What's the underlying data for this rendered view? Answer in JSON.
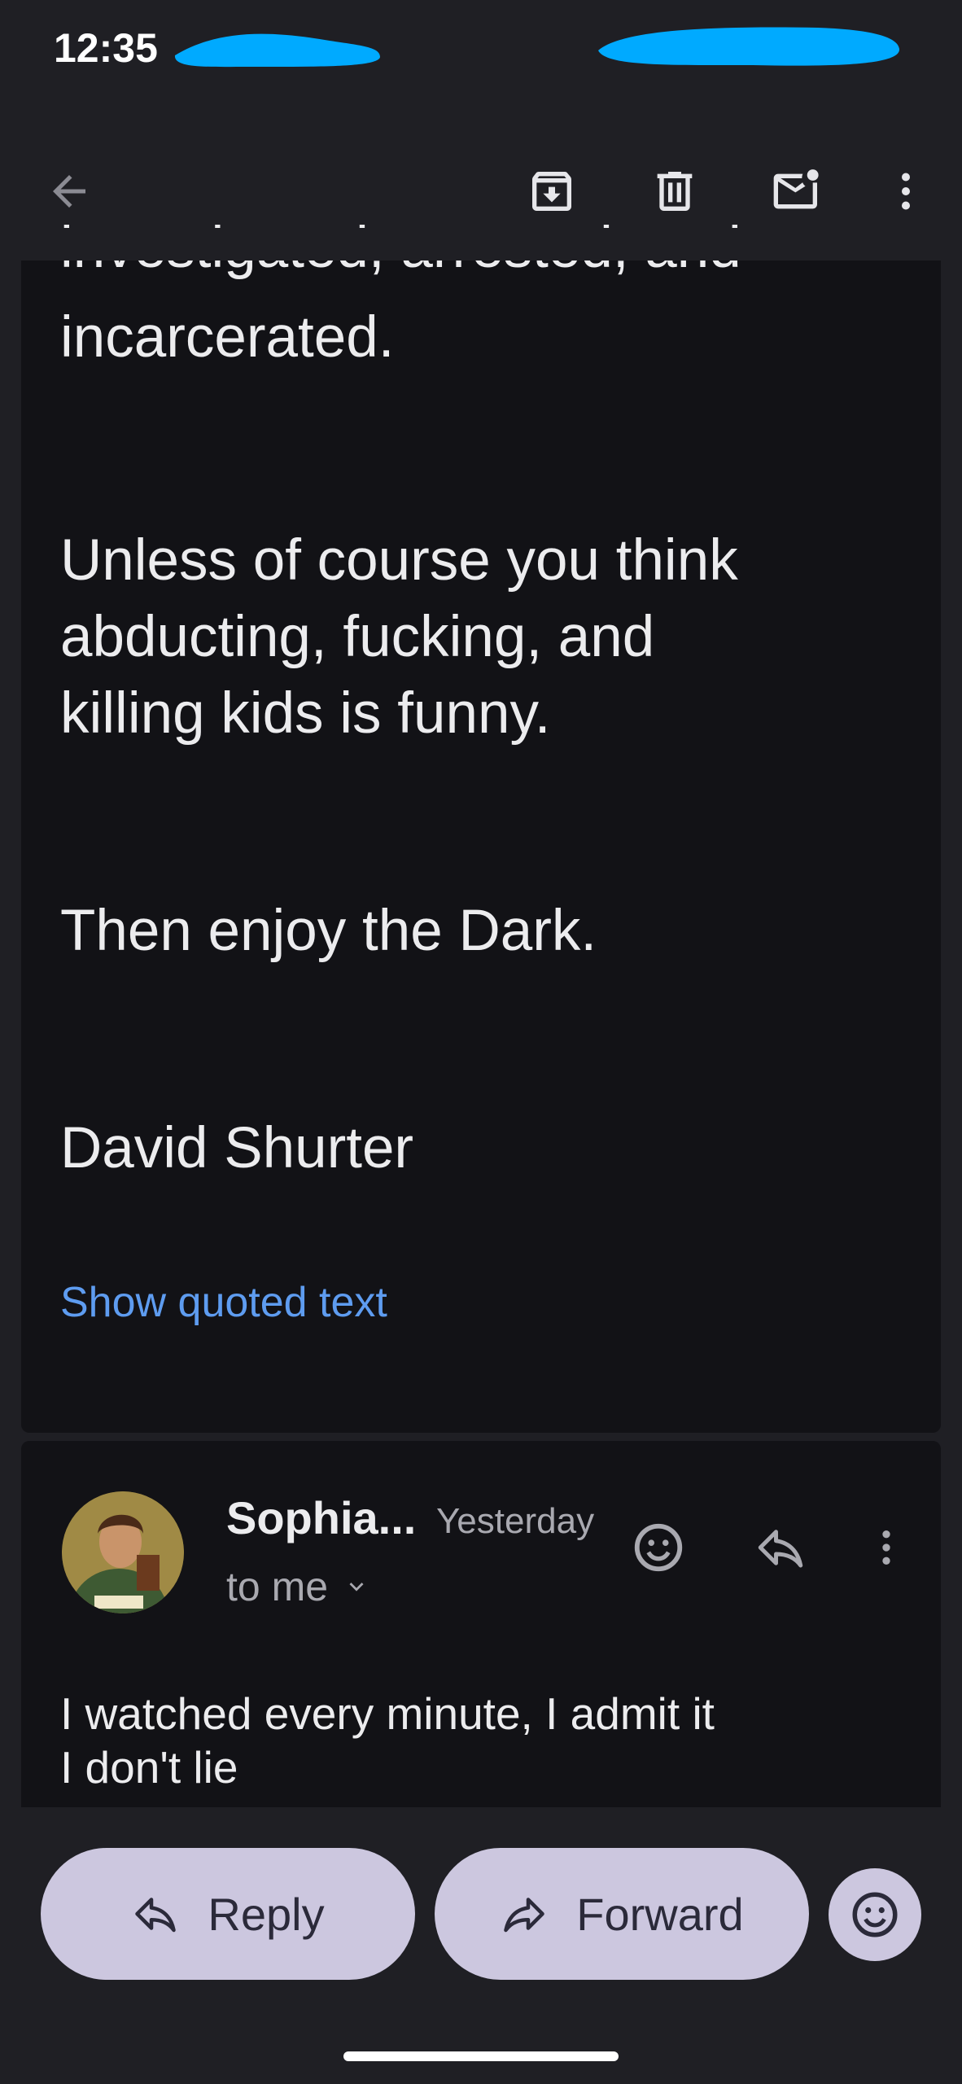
{
  "status_bar": {
    "time": "12:35"
  },
  "toolbar": {
    "back_icon": "arrow-left-icon",
    "archive_icon": "archive-icon",
    "delete_icon": "trash-icon",
    "mark_unread_icon": "mail-unread-icon",
    "more_icon": "more-vert-icon"
  },
  "email1": {
    "partial_line": "investigated, arrested, and",
    "paragraphs": [
      "incarcerated.",
      "Unless of course you think\nabducting, fucking, and\nkilling kids is funny.",
      "Then enjoy the Dark.",
      "David Shurter"
    ],
    "show_quoted_label": "Show quoted text"
  },
  "email2": {
    "sender": "Sophia...",
    "date": "Yesterday",
    "recipient": "to me",
    "body": "I watched every minute, I admit it\nI don't lie"
  },
  "actions": {
    "reply_label": "Reply",
    "forward_label": "Forward"
  },
  "colors": {
    "background": "#1f1f24",
    "card": "#121216",
    "link": "#5e9cf0",
    "pill": "#ccc7df",
    "redaction": "#00aaff"
  }
}
